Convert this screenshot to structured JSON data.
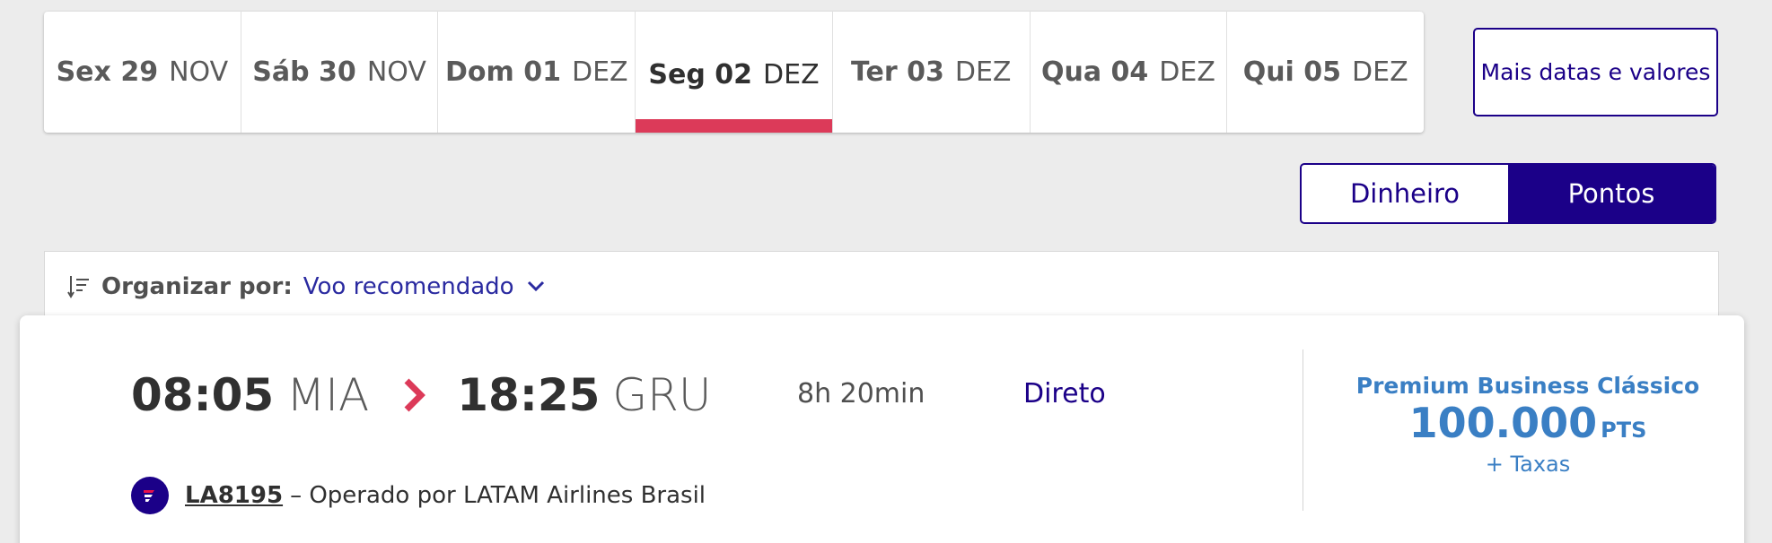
{
  "date_tabs": [
    {
      "day": "Sex 29",
      "month": "NOV",
      "active": false
    },
    {
      "day": "Sáb 30",
      "month": "NOV",
      "active": false
    },
    {
      "day": "Dom 01",
      "month": "DEZ",
      "active": false
    },
    {
      "day": "Seg 02",
      "month": "DEZ",
      "active": true
    },
    {
      "day": "Ter 03",
      "month": "DEZ",
      "active": false
    },
    {
      "day": "Qua 04",
      "month": "DEZ",
      "active": false
    },
    {
      "day": "Qui 05",
      "month": "DEZ",
      "active": false
    }
  ],
  "more_dates_label": "Mais datas e valores",
  "currency_toggle": {
    "options": [
      "Dinheiro",
      "Pontos"
    ],
    "selected": "Pontos"
  },
  "sort": {
    "label": "Organizar por:",
    "value": "Voo recomendado"
  },
  "flight": {
    "departure_time": "08:05",
    "departure_airport": "MIA",
    "arrival_time": "18:25",
    "arrival_airport": "GRU",
    "duration": "8h 20min",
    "stops": "Direto",
    "fare_name": "Premium Business Clássico",
    "price": "100.000",
    "price_unit": "PTS",
    "taxes": "+ Taxas",
    "flight_number": "LA8195",
    "operated_by": "– Operado por LATAM Airlines Brasil"
  },
  "colors": {
    "brand": "#1b0088",
    "active_tab": "#dc3a59",
    "price": "#3a7fc4",
    "arrow": "#dc3a59"
  },
  "icons": {
    "sort": "sort-lines-icon",
    "chevron": "chevron-down-icon",
    "arrow": "chevron-right-icon",
    "airline": "latam-logo-icon"
  }
}
